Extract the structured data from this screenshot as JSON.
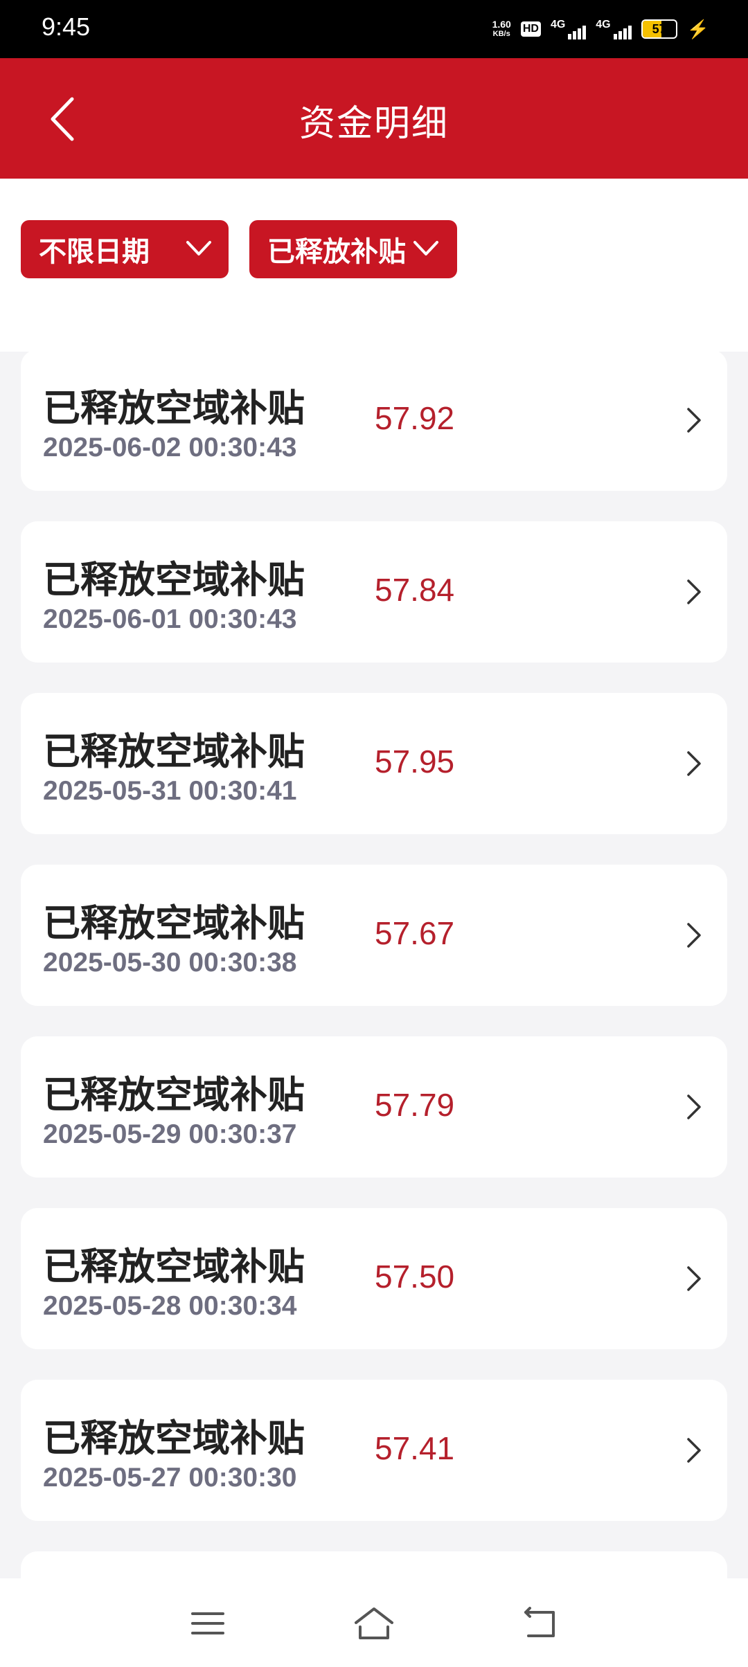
{
  "status_bar": {
    "time": "9:45",
    "net_speed_value": "1.60",
    "net_speed_unit": "KB/s",
    "hd_label": "HD",
    "sim1_label": "4G",
    "sim2_label": "4G",
    "battery_level": "57",
    "battery_fraction": 0.57,
    "battery_color": "#f4c000"
  },
  "header": {
    "title": "资金明细",
    "background": "#c81623"
  },
  "filters": {
    "date_filter_label": "不限日期",
    "type_filter_label": "已释放补贴"
  },
  "records": [
    {
      "title": "已释放空域补贴",
      "time": "2025-06-02 00:30:43",
      "amount": "57.92"
    },
    {
      "title": "已释放空域补贴",
      "time": "2025-06-01 00:30:43",
      "amount": "57.84"
    },
    {
      "title": "已释放空域补贴",
      "time": "2025-05-31 00:30:41",
      "amount": "57.95"
    },
    {
      "title": "已释放空域补贴",
      "time": "2025-05-30 00:30:38",
      "amount": "57.67"
    },
    {
      "title": "已释放空域补贴",
      "time": "2025-05-29 00:30:37",
      "amount": "57.79"
    },
    {
      "title": "已释放空域补贴",
      "time": "2025-05-28 00:30:34",
      "amount": "57.50"
    },
    {
      "title": "已释放空域补贴",
      "time": "2025-05-27 00:30:30",
      "amount": "57.41"
    }
  ],
  "icons": {
    "back": "chevron-left-icon",
    "filter_dropdown": "chevron-down-icon",
    "row_arrow": "chevron-right-icon",
    "nav_menu": "menu-icon",
    "nav_home": "home-icon",
    "nav_back": "back-icon"
  }
}
